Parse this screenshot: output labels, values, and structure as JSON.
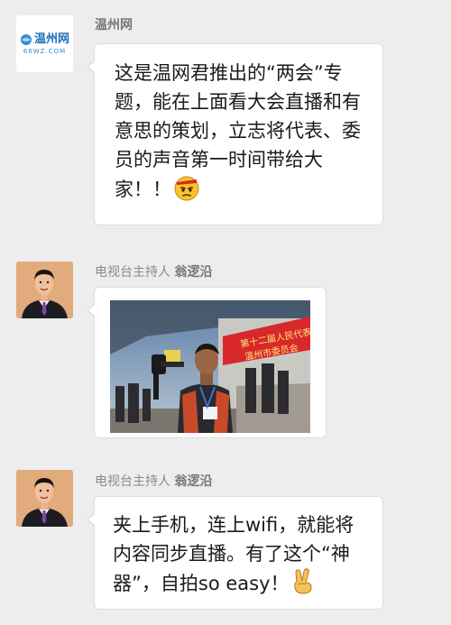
{
  "messages": [
    {
      "sender": "温州网",
      "avatar_text": "温州网",
      "avatar_sub": "66WZ.COM",
      "text": "这是温网君推出的“两会”专题，能在上面看大会直播和有意思的策划，立志将代表、委员的声音第一时间带给大家！！",
      "emoji_icon": "annoyed-face-icon"
    },
    {
      "sender_role": "电视台主持人",
      "sender_name": "翁逻沿",
      "photo_banner_line1": "第十二届人民代表大会",
      "photo_banner_line2": "温州市委员会"
    },
    {
      "sender_role": "电视台主持人",
      "sender_name": "翁逻沿",
      "text": "夹上手机，连上wifi，就能将内容同步直播。有了这个“神器”，自拍so easy！",
      "emoji_icon": "victory-hand-icon"
    }
  ],
  "colors": {
    "background": "#ededed",
    "bubble": "#ffffff",
    "sender_text": "#8a8a8a",
    "banner_red": "#d8282a"
  }
}
